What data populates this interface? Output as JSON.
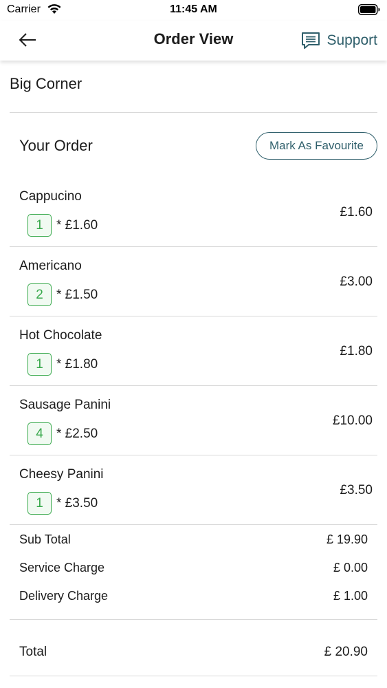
{
  "status_bar": {
    "carrier": "Carrier",
    "time": "11:45 AM"
  },
  "nav": {
    "title": "Order View",
    "support_label": "Support",
    "back_icon": "arrow-left-icon",
    "support_icon": "chat-icon"
  },
  "restaurant": {
    "name": "Big Corner"
  },
  "order": {
    "title": "Your Order",
    "favourite_label": "Mark As Favourite",
    "items": [
      {
        "name": "Cappucino",
        "qty": "1",
        "unit_price": "* £1.60",
        "total": "£1.60"
      },
      {
        "name": "Americano",
        "qty": "2",
        "unit_price": "* £1.50",
        "total": "£3.00"
      },
      {
        "name": "Hot Chocolate",
        "qty": "1",
        "unit_price": "* £1.80",
        "total": "£1.80"
      },
      {
        "name": "Sausage Panini",
        "qty": "4",
        "unit_price": "* £2.50",
        "total": "£10.00"
      },
      {
        "name": "Cheesy Panini",
        "qty": "1",
        "unit_price": "* £3.50",
        "total": "£3.50"
      }
    ]
  },
  "summary": {
    "subtotal_label": "Sub Total",
    "subtotal_value": "£ 19.90",
    "service_label": "Service Charge",
    "service_value": "£ 0.00",
    "delivery_label": "Delivery Charge",
    "delivery_value": "£ 1.00",
    "total_label": "Total",
    "total_value": "£ 20.90"
  },
  "colors": {
    "accent": "#2f5f6b",
    "quantity_green": "#36a84a",
    "divider": "#d9d9d9"
  }
}
